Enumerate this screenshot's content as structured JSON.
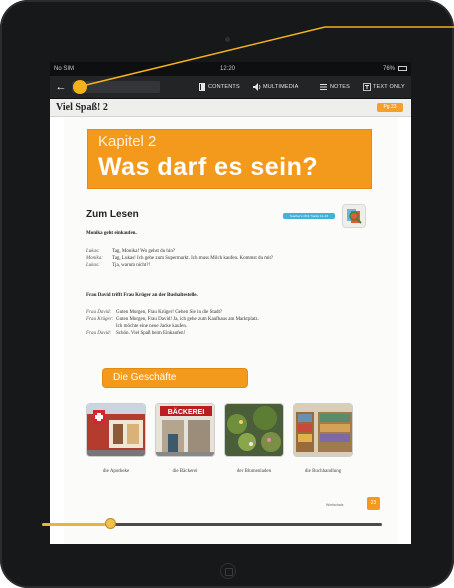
{
  "status": {
    "carrier": "No SIM",
    "time": "12:20",
    "battery": "76%"
  },
  "toolbar": {
    "back_glyph": "←",
    "search_glyph": "⚲",
    "contents_label": "CONTENTS",
    "multimedia_label": "MULTIMEDIA",
    "notes_label": "NOTES",
    "textonly_label": "TEXT ONLY"
  },
  "book": {
    "title": "Viel Spaß! 2",
    "page_badge": "Pg 23"
  },
  "chapter": {
    "kapitel": "Kapitel 2",
    "title": "Was darf es sein?"
  },
  "zum_lesen": {
    "heading": "Zum Lesen",
    "badge": "Teacher's CD1 Tracks 14–15"
  },
  "dialog1": {
    "heading": "Monika geht einkaufen.",
    "lines": [
      {
        "speaker": "Lukas:",
        "text": "Tag, Monika! Wo gehst du hin?"
      },
      {
        "speaker": "Monika:",
        "text": "Tag, Lukas! Ich gehe zum Supermarkt. Ich muss Milch kaufen. Kommst du mit?"
      },
      {
        "speaker": "Lukas:",
        "text": "Tja, warum nicht?!"
      }
    ]
  },
  "dialog2": {
    "heading": "Frau David trifft Frau Krüger an der Bushaltestelle.",
    "lines": [
      {
        "speaker": "Frau David:",
        "text": "Guten Morgen, Frau Krüger! Gehen Sie in die Stadt?"
      },
      {
        "speaker": "Frau Krüger:",
        "text": "Guten Morgen, Frau David! Ja, ich gehe zum Kaufhaus am Marktplatz."
      },
      {
        "speaker": "",
        "text": "Ich möchte eine neue Jacke kaufen."
      },
      {
        "speaker": "Frau David:",
        "text": "Schön. Viel Spaß beim Einkaufen!"
      }
    ]
  },
  "section": {
    "title": "Die Geschäfte"
  },
  "shops": [
    {
      "caption": "die Apotheke"
    },
    {
      "caption": "die Bäckerei",
      "sign": "BÄCKEREI"
    },
    {
      "caption": "der Blumenladen"
    },
    {
      "caption": "die Buchhandlung"
    }
  ],
  "footer": {
    "label": "Wortschatz",
    "page_number": "23"
  },
  "reading_progress": 0.2,
  "colors": {
    "accent": "#f39a1c",
    "callout": "#f3b21b",
    "teal": "#3fb3da"
  }
}
